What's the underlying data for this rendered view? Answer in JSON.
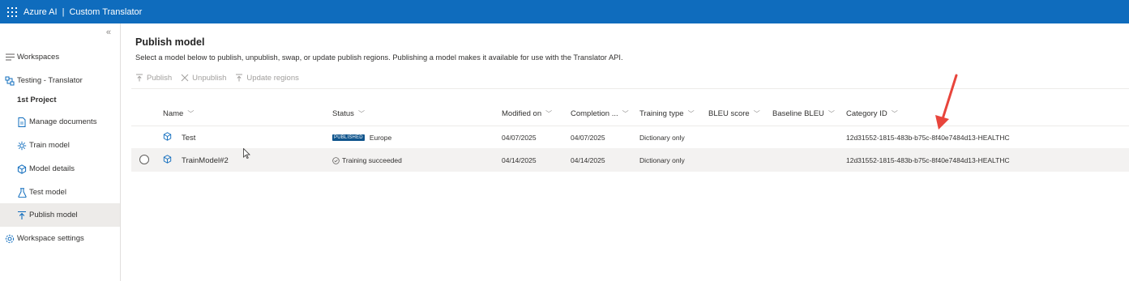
{
  "topbar": {
    "brand": "Azure AI",
    "separator": "|",
    "product": "Custom Translator"
  },
  "sidebar": {
    "collapse_glyph": "«",
    "workspaces": "Workspaces",
    "workspace_name": "Testing - Translator",
    "project": "1st Project",
    "items": [
      {
        "label": "Manage documents",
        "icon": "document-icon"
      },
      {
        "label": "Train model",
        "icon": "train-icon"
      },
      {
        "label": "Model details",
        "icon": "cube-icon"
      },
      {
        "label": "Test model",
        "icon": "flask-icon"
      },
      {
        "label": "Publish model",
        "icon": "publish-icon"
      }
    ],
    "settings": "Workspace settings"
  },
  "page": {
    "title": "Publish model",
    "subtitle": "Select a model below to publish, unpublish, swap, or update publish regions. Publishing a model makes it available for use with the Translator API."
  },
  "commands": {
    "publish": "Publish",
    "unpublish": "Unpublish",
    "update_regions": "Update regions"
  },
  "table": {
    "columns": {
      "name": "Name",
      "status": "Status",
      "modified_on": "Modified on",
      "completion": "Completion ...",
      "training_type": "Training type",
      "bleu": "BLEU score",
      "baseline": "Baseline BLEU",
      "category": "Category ID"
    },
    "rows": [
      {
        "name": "Test",
        "status_badge": "PUBLISHED",
        "status_text": "Europe",
        "modified_on": "04/07/2025",
        "completion": "04/07/2025",
        "training_type": "Dictionary only",
        "bleu": "",
        "baseline": "",
        "category": "12d31552-1815-483b-b75c-8f40e7484d13-HEALTHC"
      },
      {
        "name": "TrainModel#2",
        "status_text": "Training succeeded",
        "modified_on": "04/14/2025",
        "completion": "04/14/2025",
        "training_type": "Dictionary only",
        "bleu": "",
        "baseline": "",
        "category": "12d31552-1815-483b-b75c-8f40e7484d13-HEALTHC"
      }
    ]
  },
  "colors": {
    "brand_bar": "#0f6cbd",
    "badge": "#0f548c",
    "annotation_arrow": "#e8453c",
    "active_nav": "#edebe9"
  }
}
